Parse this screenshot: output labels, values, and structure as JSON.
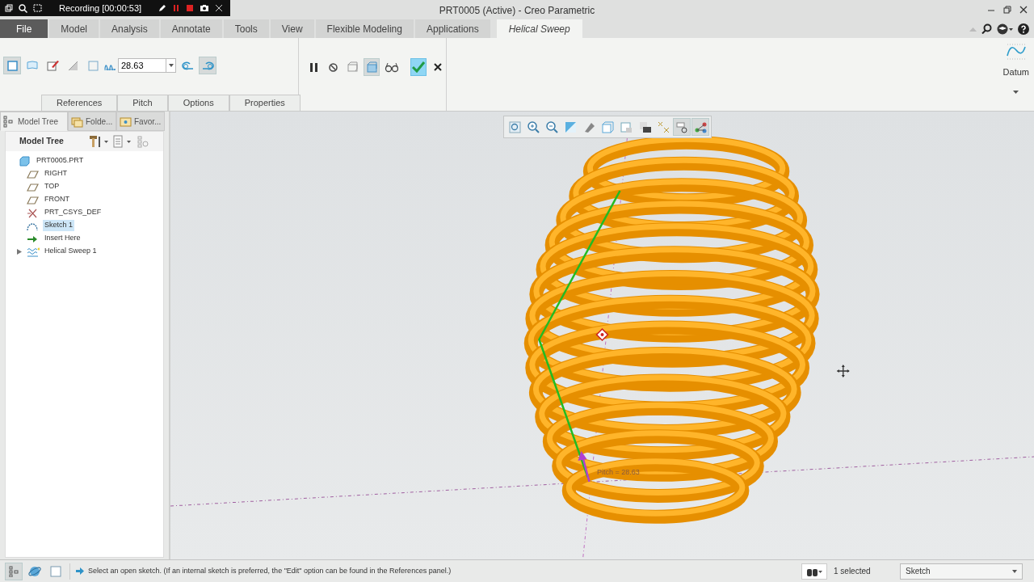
{
  "recorder": {
    "label": "Recording [00:00:53]"
  },
  "window": {
    "title": "PRT0005 (Active) - Creo Parametric"
  },
  "ribbon_tabs": [
    {
      "label": "File",
      "kind": "file",
      "selected": false
    },
    {
      "label": "Model",
      "kind": "tab",
      "selected": false
    },
    {
      "label": "Analysis",
      "kind": "tab",
      "selected": false
    },
    {
      "label": "Annotate",
      "kind": "tab",
      "selected": false
    },
    {
      "label": "Tools",
      "kind": "tab",
      "selected": false
    },
    {
      "label": "View",
      "kind": "tab",
      "selected": false
    },
    {
      "label": "Flexible Modeling",
      "kind": "tab",
      "selected": false
    },
    {
      "label": "Applications",
      "kind": "tab",
      "selected": false
    },
    {
      "label": "Helical Sweep",
      "kind": "feature",
      "selected": true
    }
  ],
  "dashboard": {
    "tools": [
      {
        "kind": "solid",
        "selected": true
      },
      {
        "kind": "surface",
        "selected": false
      },
      {
        "kind": "sketch",
        "selected": false
      },
      {
        "kind": "remove",
        "selected": false
      },
      {
        "kind": "thin",
        "selected": false
      }
    ],
    "pitch_value": "28.63",
    "handedness": [
      {
        "kind": "left",
        "selected": false
      },
      {
        "kind": "right",
        "selected": true
      }
    ],
    "controls": [
      {
        "kind": "pause",
        "selected": false
      },
      {
        "kind": "no-preview",
        "selected": false
      },
      {
        "kind": "attached",
        "selected": false
      },
      {
        "kind": "preview",
        "selected": true
      },
      {
        "kind": "verify",
        "selected": false
      }
    ],
    "panel_tabs": [
      "References",
      "Pitch",
      "Options",
      "Properties"
    ]
  },
  "datum": {
    "label": "Datum"
  },
  "navigator_tabs": [
    {
      "label": "Model Tree",
      "selected": true
    },
    {
      "label": "Folde...",
      "selected": false
    },
    {
      "label": "Favor...",
      "selected": false
    }
  ],
  "model_tree": {
    "title": "Model Tree",
    "items": [
      {
        "label": "PRT0005.PRT",
        "kind": "part",
        "selected": false,
        "children": [
          {
            "label": "RIGHT",
            "kind": "plane",
            "selected": false
          },
          {
            "label": "TOP",
            "kind": "plane",
            "selected": false
          },
          {
            "label": "FRONT",
            "kind": "plane",
            "selected": false
          },
          {
            "label": "PRT_CSYS_DEF",
            "kind": "csys",
            "selected": false
          },
          {
            "label": "Sketch 1",
            "kind": "sketch",
            "selected": true
          },
          {
            "label": "Insert Here",
            "kind": "insert",
            "selected": false
          },
          {
            "label": "Helical Sweep 1",
            "kind": "sweep",
            "selected": false,
            "expanded": false
          }
        ]
      }
    ]
  },
  "graphics": {
    "dimension_label": "Pitch = 28.63"
  },
  "status_bar": {
    "message": "Select an open sketch. (If an internal sketch is preferred, the \"Edit\" option can be found in the References panel.)",
    "selection": "1 selected",
    "filter": "Sketch"
  }
}
